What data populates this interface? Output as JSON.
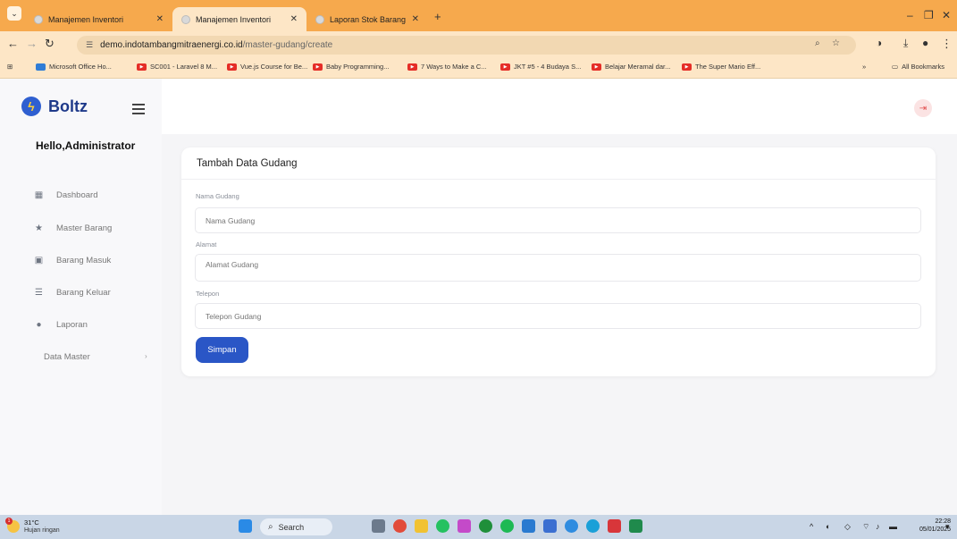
{
  "browser": {
    "tabs": [
      {
        "title": "Manajemen Inventori"
      },
      {
        "title": "Manajemen Inventori"
      },
      {
        "title": "Laporan Stok Barang"
      }
    ],
    "url_host": "demo.indotambangmitraenergi.co.id",
    "url_path": "/master-gudang/create",
    "bookmarks": [
      {
        "label": "Microsoft Office Ho..."
      },
      {
        "label": "SC001 - Laravel 8 M..."
      },
      {
        "label": "Vue.js Course for Be..."
      },
      {
        "label": "Baby Programming..."
      },
      {
        "label": "7 Ways to Make a C..."
      },
      {
        "label": "JKT #5 - 4 Budaya S..."
      },
      {
        "label": "Belajar Meramal dar..."
      },
      {
        "label": "The Super Mario Eff..."
      }
    ],
    "all_bookmarks": "All Bookmarks"
  },
  "app": {
    "brand": "Boltz",
    "greeting": "Hello,Administrator",
    "menu": [
      {
        "label": "Dashboard",
        "icon": "grid-icon"
      },
      {
        "label": "Master Barang",
        "icon": "star-icon"
      },
      {
        "label": "Barang Masuk",
        "icon": "inbox-icon"
      },
      {
        "label": "Barang Keluar",
        "icon": "list-icon"
      },
      {
        "label": "Laporan",
        "icon": "info-icon"
      }
    ],
    "submenu": {
      "label": "Data Master"
    }
  },
  "form": {
    "title": "Tambah Data Gudang",
    "fields": [
      {
        "label": "Nama Gudang",
        "placeholder": "Nama Gudang"
      },
      {
        "label": "Alamat",
        "placeholder": "Alamat Gudang"
      },
      {
        "label": "Telepon",
        "placeholder": "Telepon Gudang"
      }
    ],
    "submit": "Simpan"
  },
  "taskbar": {
    "temperature": "31°C",
    "weather": "Hujan ringan",
    "notification_count": "1",
    "search": "Search",
    "time": "22:28",
    "date": "05/01/2025"
  },
  "colors": {
    "accent": "#2a56c6",
    "tabbar": "#f6a94d",
    "logout": "#e35151"
  }
}
